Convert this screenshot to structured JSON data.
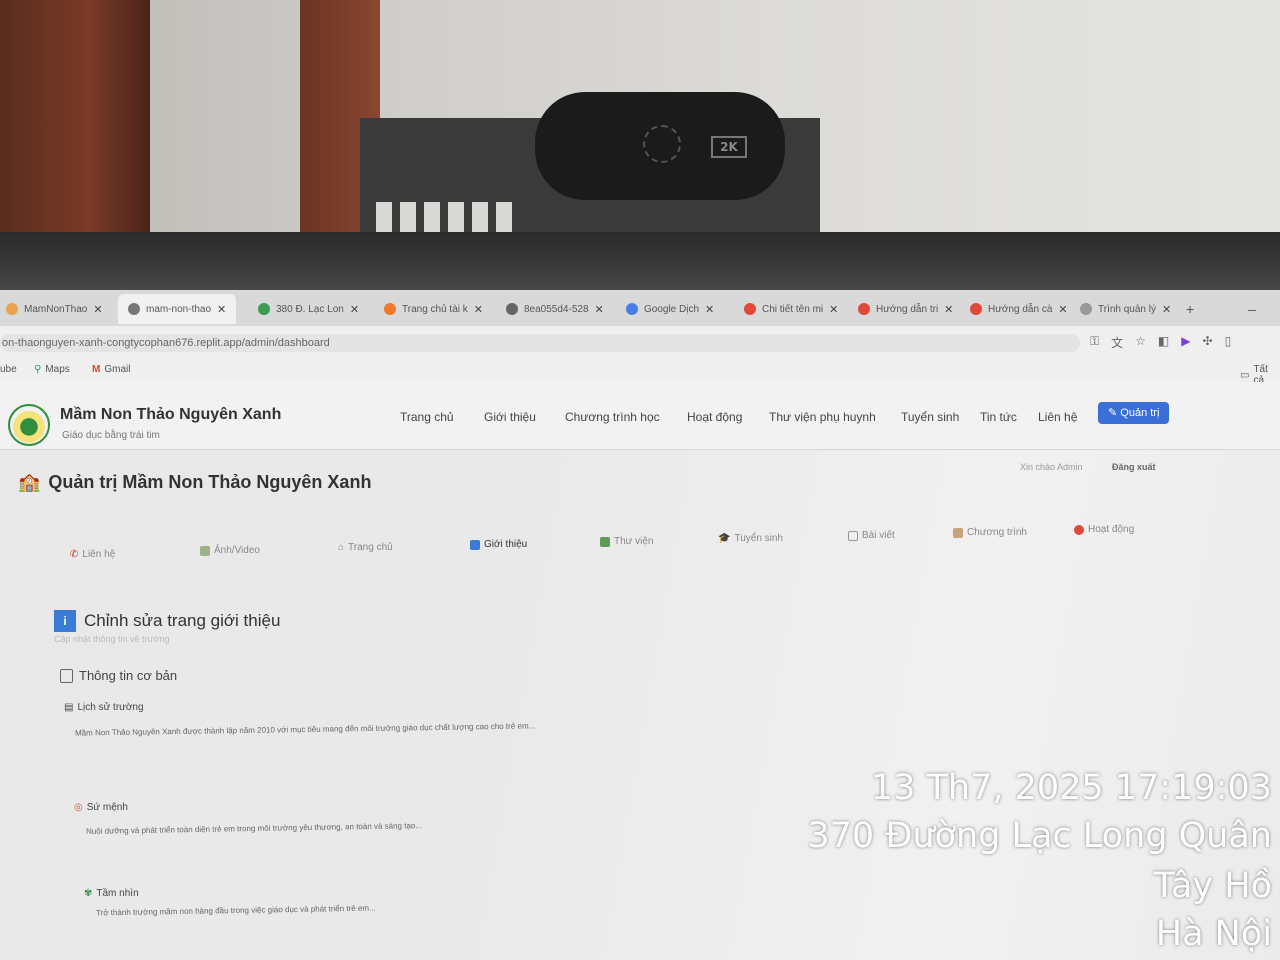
{
  "browser": {
    "tabs": [
      {
        "label": "MamNonThao"
      },
      {
        "label": "mam-non-thao"
      },
      {
        "label": "380 Đ. Lạc Lon"
      },
      {
        "label": "Trang chủ tài k"
      },
      {
        "label": "8ea055d4-528"
      },
      {
        "label": "Google Dịch"
      },
      {
        "label": "Chi tiết tên mi"
      },
      {
        "label": "Hướng dẫn tri"
      },
      {
        "label": "Hướng dẫn cà"
      },
      {
        "label": "Trình quản lý"
      }
    ],
    "url": "on-thaonguyen-xanh-congtycophan676.replit.app/admin/dashboard",
    "bookmarks": [
      {
        "label": "ube"
      },
      {
        "label": "Maps"
      },
      {
        "label": "Gmail"
      }
    ],
    "bookmarks_all": "Tất cả"
  },
  "site": {
    "brand": "Mầm Non Thảo Nguyên Xanh",
    "tagline": "Giáo dục bằng trái tim",
    "nav": [
      "Trang chủ",
      "Giới thiệu",
      "Chương trình học",
      "Hoạt động",
      "Thư viện phụ huynh",
      "Tuyển sinh",
      "Tin tức",
      "Liên hệ"
    ],
    "admin_button": "Quản trị"
  },
  "admin": {
    "title": "Quản trị Mầm Non Thảo Nguyên Xanh",
    "welcome": "Xin chào Admin",
    "logout": "Đăng xuất",
    "tabs": [
      "Liên hệ",
      "Ảnh/Video",
      "Trang chủ",
      "Giới thiệu",
      "Thư viện",
      "Tuyển sinh",
      "Bài viết",
      "Chương trình",
      "Hoạt động"
    ],
    "active_tab": "Giới thiệu",
    "section_title": "Chỉnh sửa trang giới thiệu",
    "section_subtitle": "Cập nhật thông tin về trường",
    "group_title": "Thông tin cơ bản",
    "fields": [
      {
        "label": "Lịch sử trường",
        "value": "Mầm Non Thảo Nguyên Xanh được thành lập năm 2010 với mục tiêu mang đến môi trường giáo dục chất lượng cao cho trẻ em..."
      },
      {
        "label": "Sứ mệnh",
        "value": "Nuôi dưỡng và phát triển toàn diện trẻ em trong môi trường yêu thương, an toàn và sáng tạo..."
      },
      {
        "label": "Tầm nhìn",
        "value": "Trở thành trường mầm non hàng đầu trong việc giáo dục và phát triển trẻ em..."
      }
    ]
  },
  "overlay": {
    "datetime": "13 Th7, 2025 17:19:03",
    "address": "370 Đường Lạc Long Quân",
    "district": "Tây Hồ",
    "city": "Hà Nội"
  },
  "camera": {
    "badge": "2K"
  },
  "colors": {
    "accent": "#3b6fd8",
    "info": "#3a7bd5"
  }
}
